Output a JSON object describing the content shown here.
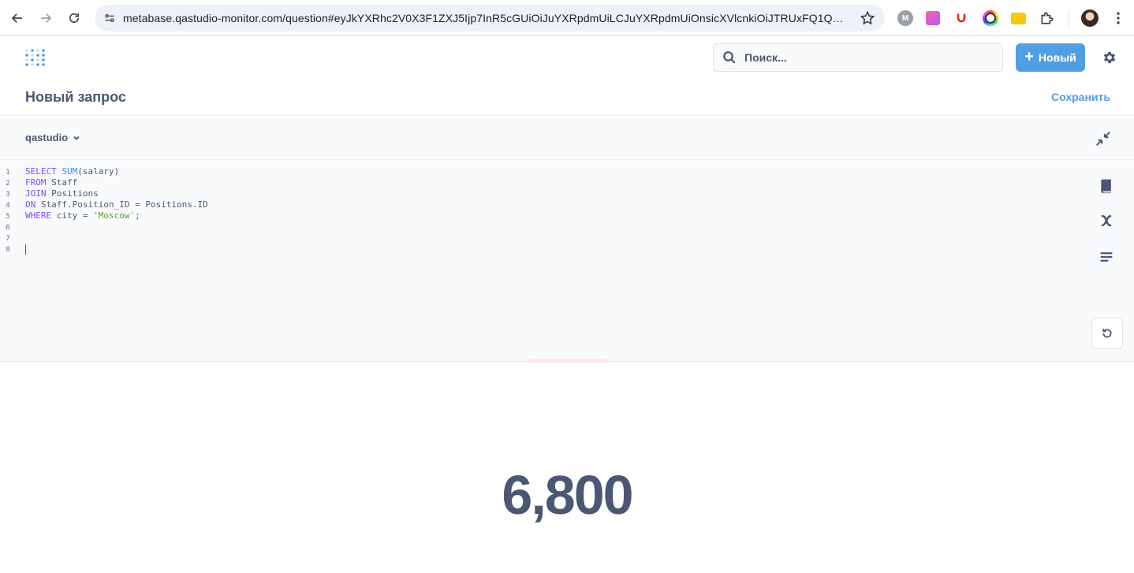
{
  "browser": {
    "url": "metabase.qastudio-monitor.com/question#eyJkYXRhc2V0X3F1ZXJ5Ijp7InR5cGUiOiJuYXRpdmUiLCJuYXRpdmUiOnsicXVlcnkiOiJTRUxFQ1QgU1VNKH...",
    "ext_m_label": "M"
  },
  "nav": {
    "search_placeholder": "Поиск...",
    "new_button": "Новый"
  },
  "question": {
    "title": "Новый запрос",
    "save_label": "Сохранить"
  },
  "editor": {
    "database": "qastudio",
    "line_numbers": [
      "1",
      "2",
      "3",
      "4",
      "5",
      "6",
      "7",
      "8"
    ]
  },
  "result": {
    "value": "6,800"
  },
  "colors": {
    "brand": "#509ee3",
    "text": "#4c5773"
  }
}
